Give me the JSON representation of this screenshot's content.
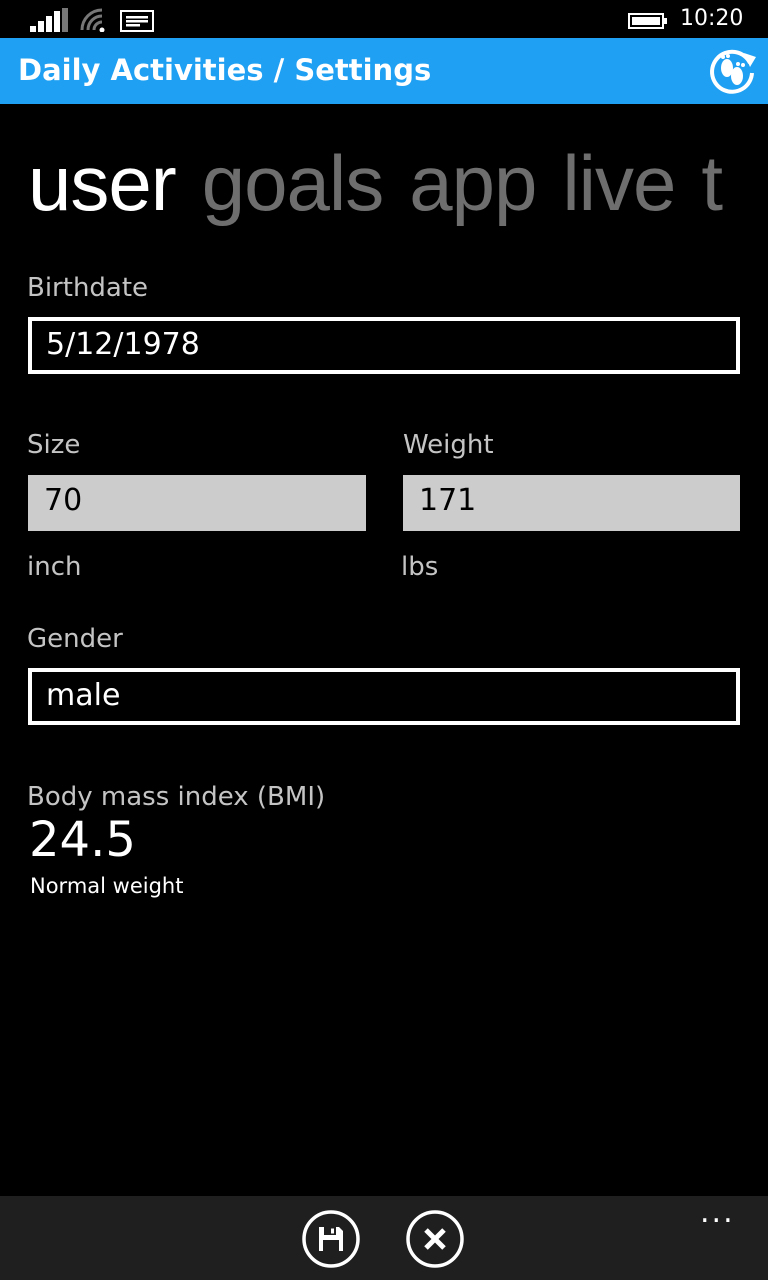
{
  "status_bar": {
    "time": "10:20",
    "icons": [
      "signal-icon",
      "wifi-icon",
      "message-icon",
      "battery-icon"
    ]
  },
  "header": {
    "title": "Daily Activities / Settings",
    "background_color": "#1fa0f2",
    "sync_icon": "sync-footsteps-icon"
  },
  "pivot": {
    "tabs": [
      {
        "label": "user",
        "active": true
      },
      {
        "label": "goals",
        "active": false
      },
      {
        "label": "app",
        "active": false
      },
      {
        "label": "live",
        "active": false
      },
      {
        "label": "t",
        "active": false
      }
    ]
  },
  "form": {
    "birthdate": {
      "label": "Birthdate",
      "value": "5/12/1978"
    },
    "size": {
      "label": "Size",
      "value": "70",
      "unit": "inch"
    },
    "weight": {
      "label": "Weight",
      "value": "171",
      "unit": "lbs"
    },
    "gender": {
      "label": "Gender",
      "value": "male"
    }
  },
  "bmi": {
    "label": "Body mass index (BMI)",
    "value": "24.5",
    "category": "Normal weight"
  },
  "appbar": {
    "buttons": [
      "save-icon",
      "cancel-icon"
    ],
    "more": "..."
  }
}
